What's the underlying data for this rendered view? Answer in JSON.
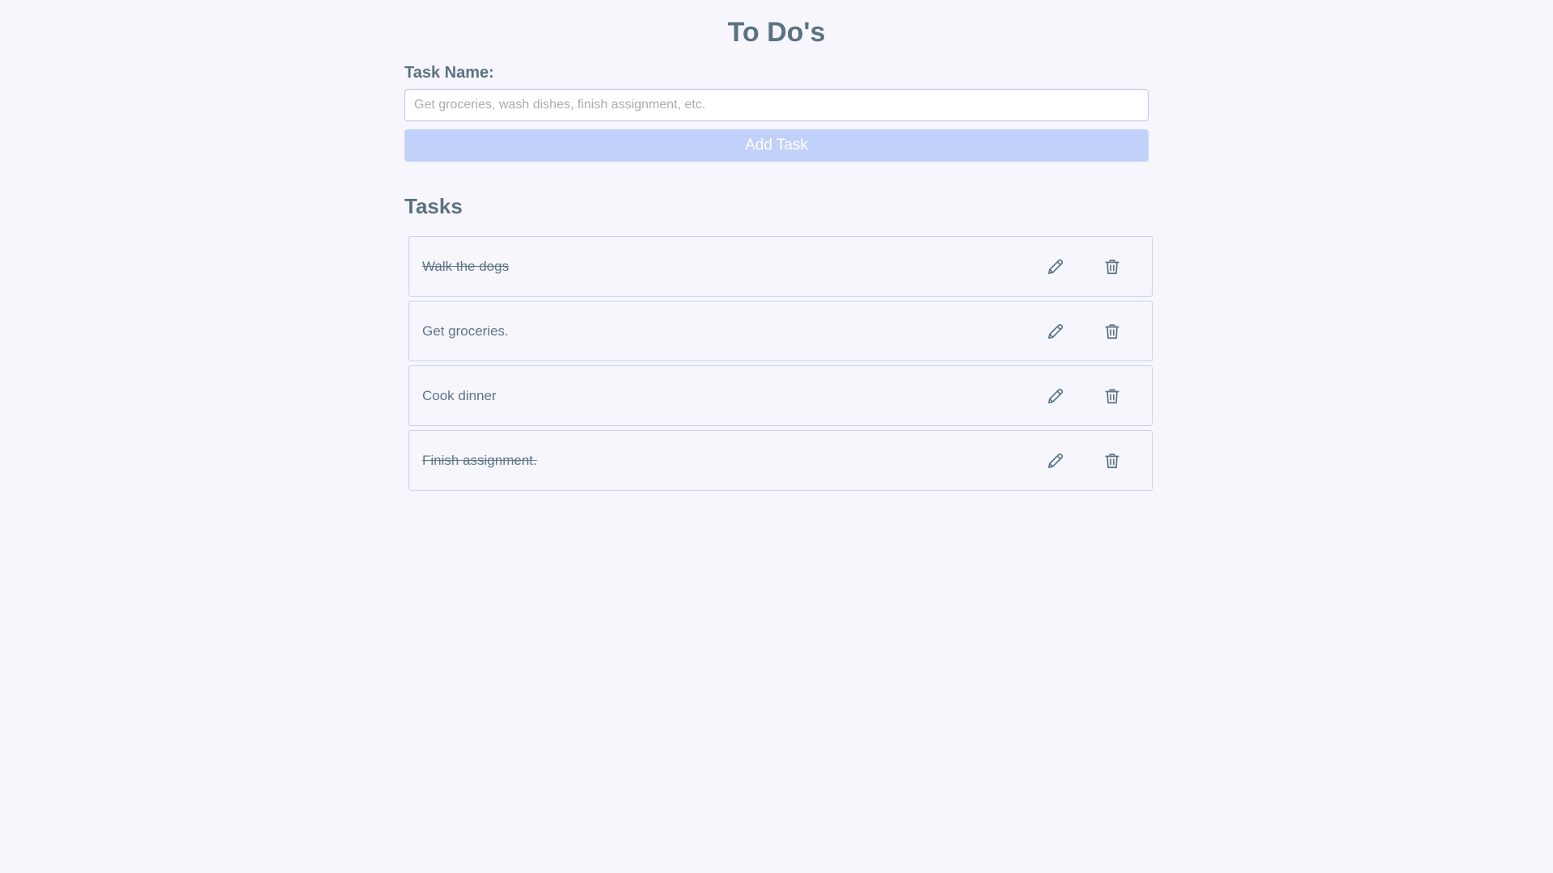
{
  "header": {
    "title": "To Do's"
  },
  "form": {
    "label": "Task Name:",
    "placeholder": "Get groceries, wash dishes, finish assignment, etc.",
    "value": "",
    "add_button_label": "Add Task"
  },
  "tasks_section": {
    "title": "Tasks",
    "items": [
      {
        "text": "Walk the dogs",
        "completed": true
      },
      {
        "text": "Get groceries.",
        "completed": false
      },
      {
        "text": "Cook dinner",
        "completed": false
      },
      {
        "text": "Finish assignment.",
        "completed": true
      }
    ],
    "edit_icon": "pencil-icon",
    "delete_icon": "trash-icon"
  },
  "colors": {
    "background": "#f7f6fd",
    "text": "#5a7282",
    "add_button": "#c1d1fa",
    "border": "#c6d0ea"
  }
}
